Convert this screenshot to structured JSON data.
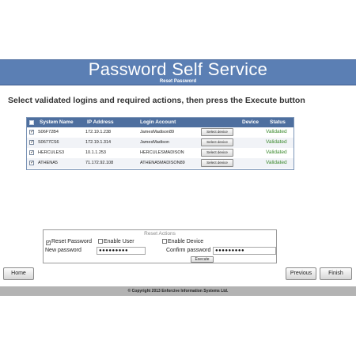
{
  "header": {
    "title": "Password Self Service",
    "subtitle": "Reset Password"
  },
  "instruction": "Select validated logins and required actions, then press the Execute button",
  "grid": {
    "columns": [
      "System Name",
      "IP Address",
      "Login Account",
      "Device",
      "Status"
    ],
    "select_device_label": "Select device",
    "rows": [
      {
        "checked": true,
        "system": "S06F72B4",
        "ip": "172.19.1.238",
        "login": "JamesMadison89",
        "status": "Validated"
      },
      {
        "checked": true,
        "system": "S0677CS6",
        "ip": "172.19.1.314",
        "login": "JamesMadison",
        "status": "Validated"
      },
      {
        "checked": true,
        "system": "HERCULES3",
        "ip": "10.1.1.253",
        "login": "HERCULESMADISON",
        "status": "Validated"
      },
      {
        "checked": true,
        "system": "ATHENA5",
        "ip": "71.172.92.108",
        "login": "ATHENA5MADISON89",
        "status": "Validated"
      }
    ]
  },
  "reset_actions": {
    "legend": "Reset Actions",
    "reset_password_label": "Reset Password",
    "reset_password_checked": true,
    "enable_user_label": "Enable User",
    "enable_user_checked": false,
    "enable_device_label": "Enable Device",
    "enable_device_checked": false,
    "new_password_label": "New password",
    "new_password_value": "●●●●●●●●●",
    "confirm_password_label": "Confirm password",
    "confirm_password_value": "●●●●●●●●●",
    "execute_label": "Execute"
  },
  "nav": {
    "home_label": "Home",
    "previous_label": "Previous",
    "finish_label": "Finish"
  },
  "footer": {
    "copyright": "© Copyright 2013 Enforcive Information Systems Ltd."
  },
  "colors": {
    "banner": "#5b7fb4",
    "grid_header": "#4e6f9f",
    "status_validated": "#3c8a2e",
    "footer": "#b3b3b3"
  }
}
